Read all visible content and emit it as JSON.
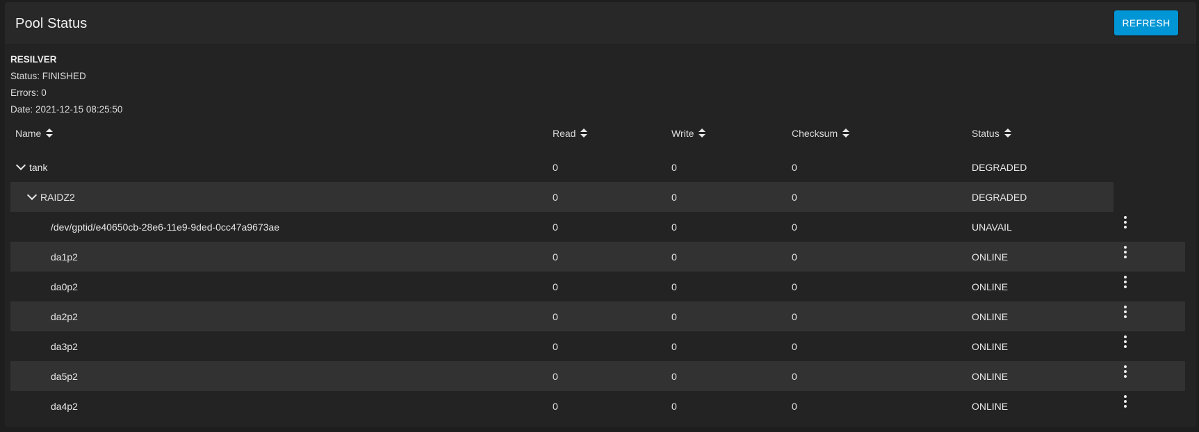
{
  "card": {
    "title": "Pool Status",
    "refresh_label": "REFRESH"
  },
  "scan": {
    "type": "RESILVER",
    "status": "Status: FINISHED",
    "errors": "Errors: 0",
    "date": "Date: 2021-12-15 08:25:50"
  },
  "table": {
    "columns": [
      "Name",
      "Read",
      "Write",
      "Checksum",
      "Status"
    ],
    "rows": [
      {
        "name": "tank",
        "read": "0",
        "write": "0",
        "checksum": "0",
        "status": "DEGRADED",
        "level": 0,
        "expandable": true,
        "shaded": false,
        "has_menu": false
      },
      {
        "name": "RAIDZ2",
        "read": "0",
        "write": "0",
        "checksum": "0",
        "status": "DEGRADED",
        "level": 1,
        "expandable": true,
        "shaded": true,
        "has_menu": false
      },
      {
        "name": "/dev/gptid/e40650cb-28e6-11e9-9ded-0cc47a9673ae",
        "read": "0",
        "write": "0",
        "checksum": "0",
        "status": "UNAVAIL",
        "level": 2,
        "expandable": false,
        "shaded": false,
        "has_menu": true
      },
      {
        "name": "da1p2",
        "read": "0",
        "write": "0",
        "checksum": "0",
        "status": "ONLINE",
        "level": 2,
        "expandable": false,
        "shaded": true,
        "has_menu": true
      },
      {
        "name": "da0p2",
        "read": "0",
        "write": "0",
        "checksum": "0",
        "status": "ONLINE",
        "level": 2,
        "expandable": false,
        "shaded": false,
        "has_menu": true
      },
      {
        "name": "da2p2",
        "read": "0",
        "write": "0",
        "checksum": "0",
        "status": "ONLINE",
        "level": 2,
        "expandable": false,
        "shaded": true,
        "has_menu": true
      },
      {
        "name": "da3p2",
        "read": "0",
        "write": "0",
        "checksum": "0",
        "status": "ONLINE",
        "level": 2,
        "expandable": false,
        "shaded": false,
        "has_menu": true
      },
      {
        "name": "da5p2",
        "read": "0",
        "write": "0",
        "checksum": "0",
        "status": "ONLINE",
        "level": 2,
        "expandable": false,
        "shaded": true,
        "has_menu": true
      },
      {
        "name": "da4p2",
        "read": "0",
        "write": "0",
        "checksum": "0",
        "status": "ONLINE",
        "level": 2,
        "expandable": false,
        "shaded": false,
        "has_menu": true
      }
    ]
  },
  "icons": {
    "sort": "sort-icon",
    "expand": "chevron-down-icon",
    "row_menu": "more-vertical-icon"
  },
  "colors": {
    "accent": "#0095d5",
    "background": "#232323",
    "header": "#282828",
    "row_shade": "#323232"
  }
}
